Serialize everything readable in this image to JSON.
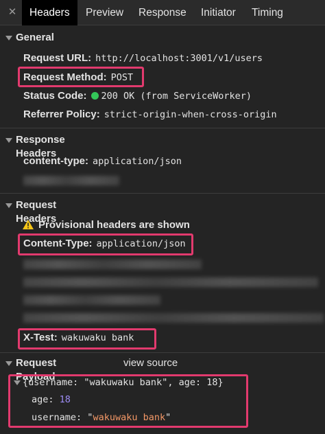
{
  "tabs": {
    "close": "✕",
    "items": [
      "Headers",
      "Preview",
      "Response",
      "Initiator",
      "Timing"
    ],
    "active": "Headers"
  },
  "general": {
    "title": "General",
    "request_url_key": "Request URL:",
    "request_url_val": "http://localhost:3001/v1/users",
    "method_key": "Request Method:",
    "method_val": "POST",
    "status_key": "Status Code:",
    "status_val": "200 OK (from ServiceWorker)",
    "referrer_key": "Referrer Policy:",
    "referrer_val": "strict-origin-when-cross-origin"
  },
  "response_headers": {
    "title": "Response Headers",
    "content_type_key": "content-type:",
    "content_type_val": "application/json"
  },
  "request_headers": {
    "title": "Request Headers",
    "provisional_notice": "Provisional headers are shown",
    "content_type_key": "Content-Type:",
    "content_type_val": "application/json",
    "x_test_key": "X-Test:",
    "x_test_val": "wakuwaku bank"
  },
  "request_payload": {
    "title": "Request Payload",
    "view_source": "view source",
    "summary": "{username: \"wakuwaku bank\", age: 18}",
    "age_key": "age:",
    "age_val": "18",
    "username_key": "username:",
    "username_val": "\"wakuwaku bank\"",
    "username_quote_open": "\"",
    "username_text": "wakuwaku bank",
    "username_quote_close": "\""
  },
  "colors": {
    "highlight": "#e23a6e",
    "status_ok": "#34c759",
    "number": "#9d8cf5",
    "string": "#f29766",
    "warning": "#f5c518"
  }
}
